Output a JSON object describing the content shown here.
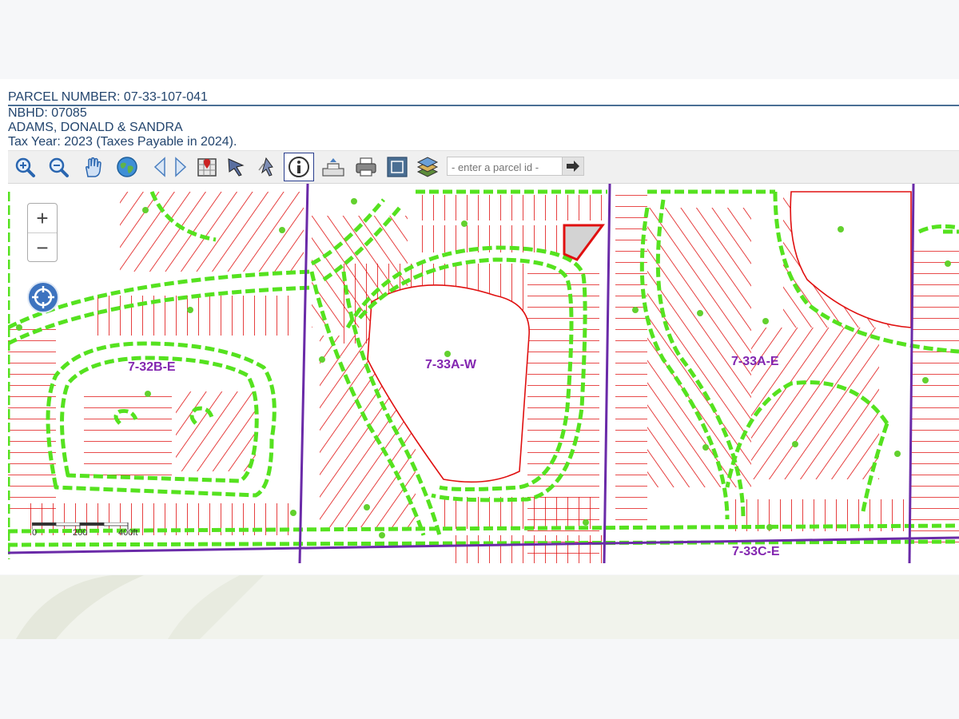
{
  "parcel": {
    "number_line": "PARCEL NUMBER: 07-33-107-041",
    "nbhd_line": "NBHD: 07085",
    "owner_line": "ADAMS, DONALD & SANDRA",
    "tax_line": "Tax Year: 2023 (Taxes Payable in 2024)."
  },
  "toolbar": {
    "tools": [
      {
        "icon": "zoom-in-icon"
      },
      {
        "icon": "zoom-out-icon"
      },
      {
        "icon": "pan-hand-icon"
      },
      {
        "icon": "globe-icon"
      },
      {
        "icon": "back-arrow-icon"
      },
      {
        "icon": "forward-arrow-icon"
      },
      {
        "icon": "map-marker-icon"
      },
      {
        "icon": "select-arrow-icon"
      },
      {
        "icon": "select-polygon-icon"
      },
      {
        "icon": "info-icon",
        "active": true
      },
      {
        "icon": "buffer-icon"
      },
      {
        "icon": "print-icon"
      },
      {
        "icon": "fullscreen-icon"
      },
      {
        "icon": "layers-icon"
      }
    ],
    "search_placeholder": "- enter a parcel id -"
  },
  "map": {
    "zoom_in": "+",
    "zoom_out": "−",
    "labels": [
      "7-32B-E",
      "7-33A-W",
      "7-33A-E",
      "7-33C-E"
    ],
    "scale": {
      "start": "0",
      "mid": "200",
      "end": "400ft"
    },
    "colors": {
      "parcel_line": "#e01010",
      "road": "#55e21f",
      "section_line": "#6a2aa8",
      "selected": "#d3d3d3"
    }
  }
}
